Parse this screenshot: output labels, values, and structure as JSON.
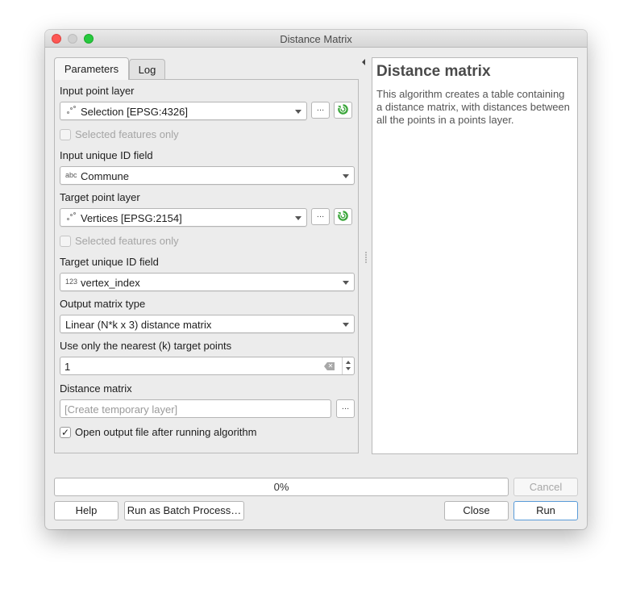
{
  "window": {
    "title": "Distance Matrix"
  },
  "tabs": [
    {
      "label": "Parameters",
      "active": true
    },
    {
      "label": "Log",
      "active": false
    }
  ],
  "params": {
    "input_point_layer": {
      "label": "Input point layer",
      "value": "Selection [EPSG:4326]",
      "icon": "point-layer-icon",
      "more_button": "…",
      "selected_only_label": "Selected features only",
      "selected_only_checked": false
    },
    "input_unique_id": {
      "label": "Input unique ID field",
      "type_badge": "abc",
      "value": "Commune"
    },
    "target_point_layer": {
      "label": "Target point layer",
      "value": "Vertices [EPSG:2154]",
      "icon": "point-layer-icon",
      "more_button": "…",
      "selected_only_label": "Selected features only",
      "selected_only_checked": false
    },
    "target_unique_id": {
      "label": "Target unique ID field",
      "type_badge": "123",
      "value": "vertex_index"
    },
    "output_matrix_type": {
      "label": "Output matrix type",
      "value": "Linear (N*k x 3) distance matrix"
    },
    "nearest_k": {
      "label": "Use only the nearest (k) target points",
      "value": "1"
    },
    "distance_matrix": {
      "label": "Distance matrix",
      "placeholder": "[Create temporary layer]",
      "more_button": "…"
    },
    "open_output": {
      "label": "Open output file after running algorithm",
      "checked": true,
      "check_glyph": "✓"
    }
  },
  "help": {
    "title": "Distance matrix",
    "text": "This algorithm creates a table containing a distance matrix, with distances between all the points in a points layer."
  },
  "progress": {
    "value_percent": 0,
    "label": "0%"
  },
  "buttons": {
    "cancel": "Cancel",
    "help": "Help",
    "batch": "Run as Batch Process…",
    "close": "Close",
    "run": "Run"
  },
  "colors": {
    "close_light": "#fd5754",
    "max_light": "#27c93f",
    "refresh_icon": "#3aa63a",
    "run_border": "#5a9bd8"
  }
}
